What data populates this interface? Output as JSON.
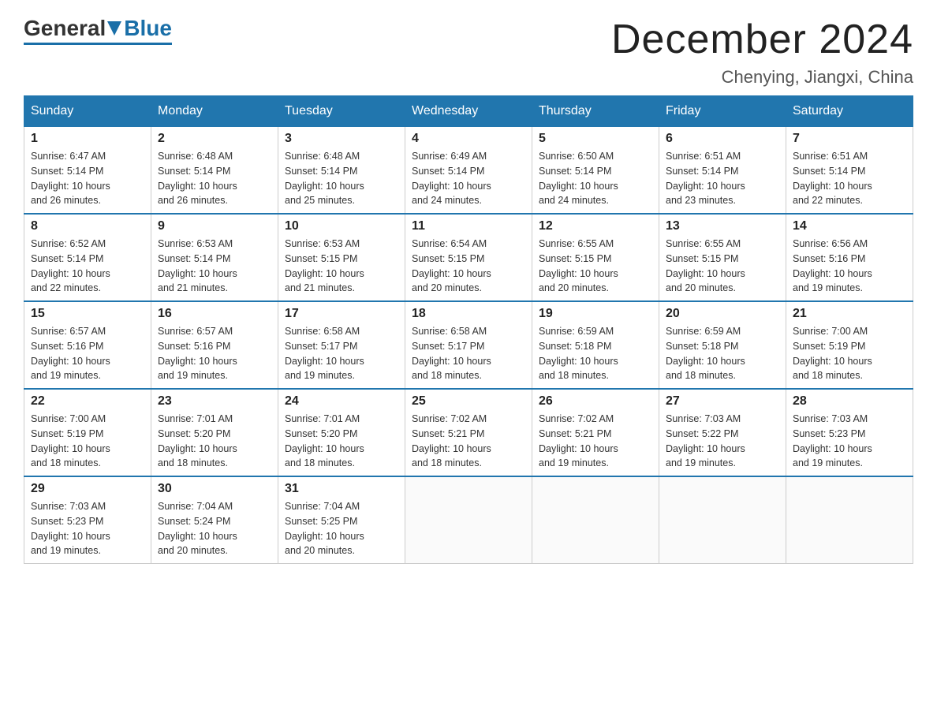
{
  "header": {
    "logo_general": "General",
    "logo_blue": "Blue",
    "month_title": "December 2024",
    "location": "Chenying, Jiangxi, China"
  },
  "weekdays": [
    "Sunday",
    "Monday",
    "Tuesday",
    "Wednesday",
    "Thursday",
    "Friday",
    "Saturday"
  ],
  "weeks": [
    [
      {
        "day": "1",
        "sunrise": "6:47 AM",
        "sunset": "5:14 PM",
        "daylight": "10 hours and 26 minutes."
      },
      {
        "day": "2",
        "sunrise": "6:48 AM",
        "sunset": "5:14 PM",
        "daylight": "10 hours and 26 minutes."
      },
      {
        "day": "3",
        "sunrise": "6:48 AM",
        "sunset": "5:14 PM",
        "daylight": "10 hours and 25 minutes."
      },
      {
        "day": "4",
        "sunrise": "6:49 AM",
        "sunset": "5:14 PM",
        "daylight": "10 hours and 24 minutes."
      },
      {
        "day": "5",
        "sunrise": "6:50 AM",
        "sunset": "5:14 PM",
        "daylight": "10 hours and 24 minutes."
      },
      {
        "day": "6",
        "sunrise": "6:51 AM",
        "sunset": "5:14 PM",
        "daylight": "10 hours and 23 minutes."
      },
      {
        "day": "7",
        "sunrise": "6:51 AM",
        "sunset": "5:14 PM",
        "daylight": "10 hours and 22 minutes."
      }
    ],
    [
      {
        "day": "8",
        "sunrise": "6:52 AM",
        "sunset": "5:14 PM",
        "daylight": "10 hours and 22 minutes."
      },
      {
        "day": "9",
        "sunrise": "6:53 AM",
        "sunset": "5:14 PM",
        "daylight": "10 hours and 21 minutes."
      },
      {
        "day": "10",
        "sunrise": "6:53 AM",
        "sunset": "5:15 PM",
        "daylight": "10 hours and 21 minutes."
      },
      {
        "day": "11",
        "sunrise": "6:54 AM",
        "sunset": "5:15 PM",
        "daylight": "10 hours and 20 minutes."
      },
      {
        "day": "12",
        "sunrise": "6:55 AM",
        "sunset": "5:15 PM",
        "daylight": "10 hours and 20 minutes."
      },
      {
        "day": "13",
        "sunrise": "6:55 AM",
        "sunset": "5:15 PM",
        "daylight": "10 hours and 20 minutes."
      },
      {
        "day": "14",
        "sunrise": "6:56 AM",
        "sunset": "5:16 PM",
        "daylight": "10 hours and 19 minutes."
      }
    ],
    [
      {
        "day": "15",
        "sunrise": "6:57 AM",
        "sunset": "5:16 PM",
        "daylight": "10 hours and 19 minutes."
      },
      {
        "day": "16",
        "sunrise": "6:57 AM",
        "sunset": "5:16 PM",
        "daylight": "10 hours and 19 minutes."
      },
      {
        "day": "17",
        "sunrise": "6:58 AM",
        "sunset": "5:17 PM",
        "daylight": "10 hours and 19 minutes."
      },
      {
        "day": "18",
        "sunrise": "6:58 AM",
        "sunset": "5:17 PM",
        "daylight": "10 hours and 18 minutes."
      },
      {
        "day": "19",
        "sunrise": "6:59 AM",
        "sunset": "5:18 PM",
        "daylight": "10 hours and 18 minutes."
      },
      {
        "day": "20",
        "sunrise": "6:59 AM",
        "sunset": "5:18 PM",
        "daylight": "10 hours and 18 minutes."
      },
      {
        "day": "21",
        "sunrise": "7:00 AM",
        "sunset": "5:19 PM",
        "daylight": "10 hours and 18 minutes."
      }
    ],
    [
      {
        "day": "22",
        "sunrise": "7:00 AM",
        "sunset": "5:19 PM",
        "daylight": "10 hours and 18 minutes."
      },
      {
        "day": "23",
        "sunrise": "7:01 AM",
        "sunset": "5:20 PM",
        "daylight": "10 hours and 18 minutes."
      },
      {
        "day": "24",
        "sunrise": "7:01 AM",
        "sunset": "5:20 PM",
        "daylight": "10 hours and 18 minutes."
      },
      {
        "day": "25",
        "sunrise": "7:02 AM",
        "sunset": "5:21 PM",
        "daylight": "10 hours and 18 minutes."
      },
      {
        "day": "26",
        "sunrise": "7:02 AM",
        "sunset": "5:21 PM",
        "daylight": "10 hours and 19 minutes."
      },
      {
        "day": "27",
        "sunrise": "7:03 AM",
        "sunset": "5:22 PM",
        "daylight": "10 hours and 19 minutes."
      },
      {
        "day": "28",
        "sunrise": "7:03 AM",
        "sunset": "5:23 PM",
        "daylight": "10 hours and 19 minutes."
      }
    ],
    [
      {
        "day": "29",
        "sunrise": "7:03 AM",
        "sunset": "5:23 PM",
        "daylight": "10 hours and 19 minutes."
      },
      {
        "day": "30",
        "sunrise": "7:04 AM",
        "sunset": "5:24 PM",
        "daylight": "10 hours and 20 minutes."
      },
      {
        "day": "31",
        "sunrise": "7:04 AM",
        "sunset": "5:25 PM",
        "daylight": "10 hours and 20 minutes."
      },
      null,
      null,
      null,
      null
    ]
  ],
  "labels": {
    "sunrise": "Sunrise:",
    "sunset": "Sunset:",
    "daylight": "Daylight:"
  }
}
